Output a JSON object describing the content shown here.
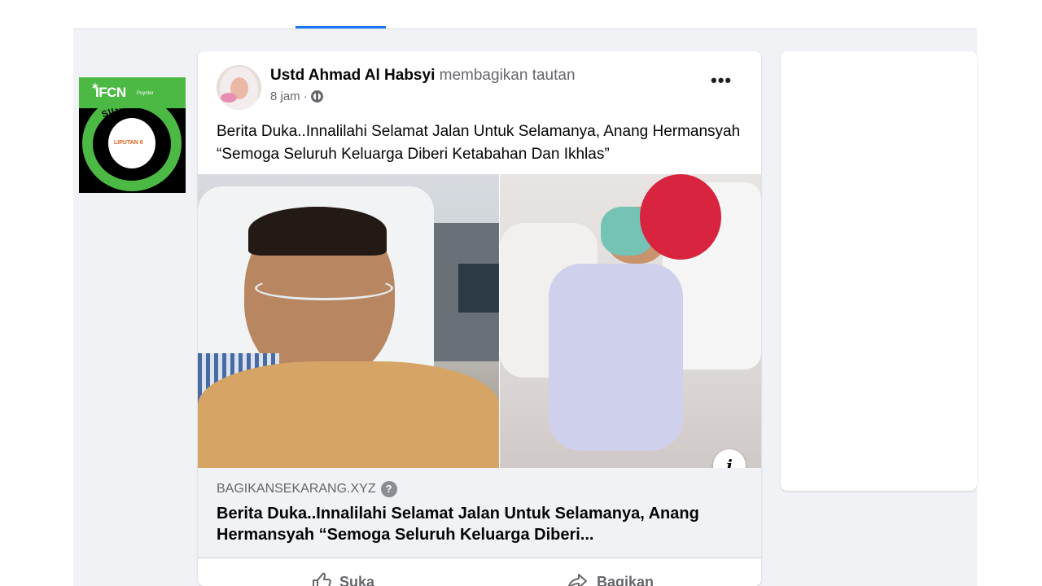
{
  "post": {
    "author": "Ustd Ahmad Al Habsyi",
    "action": "membagikan tautan",
    "time": "8 jam",
    "separator": "·",
    "text": "Berita Duka..Innalilahi Selamat Jalan Untuk Selamanya, Anang Hermansyah “Semoga Seluruh Keluarga Diberi Ketabahan Dan Ikhlas”",
    "link": {
      "domain": "BAGIKANSEKARANG.XYZ",
      "title": "Berita Duka..Innalilahi Selamat Jalan Untuk Selamanya, Anang Hermansyah “Semoga Seluruh Keluarga Diberi..."
    },
    "actions": {
      "like": "Suka",
      "share": "Bagikan"
    }
  },
  "badge": {
    "ifcn": "IFCN",
    "poynter": "Poynter",
    "signatory": "SIGNATORY",
    "logo": "LIPUTAN 6"
  },
  "icons": {
    "more": "more-options-icon",
    "globe": "globe-icon",
    "info": "info-icon",
    "help": "question-icon",
    "like": "thumbs-up-icon",
    "share": "share-arrow-icon"
  },
  "colors": {
    "accent": "#1877f2",
    "feed_bg": "#f0f2f5",
    "badge_green": "#4cb944"
  }
}
